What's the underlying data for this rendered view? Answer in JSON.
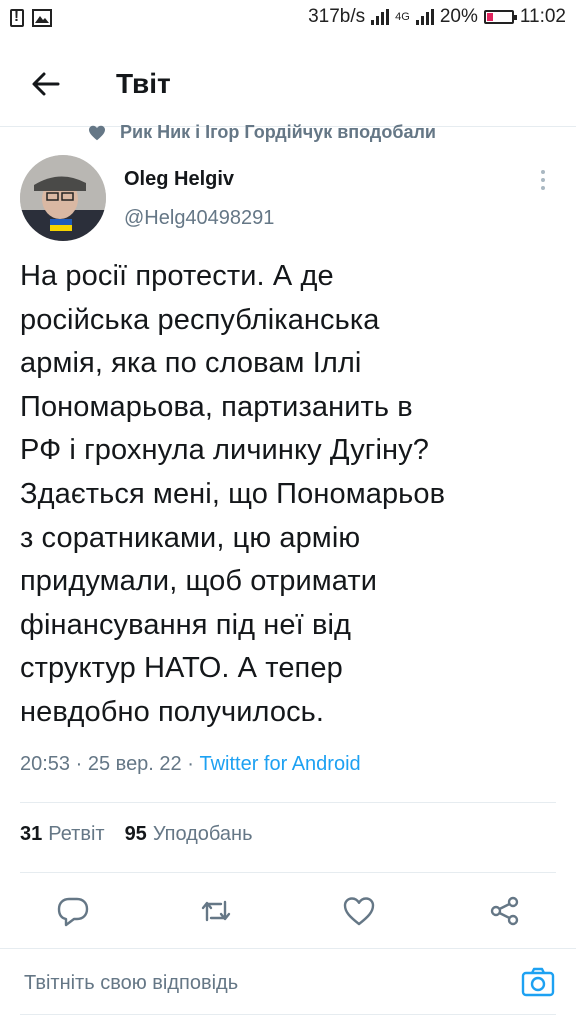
{
  "status_bar": {
    "net_speed": "317b/s",
    "network_type": "4G",
    "battery": "20%",
    "time": "11:02",
    "icons": [
      "alert-icon",
      "image-icon",
      "signal-icon",
      "battery-icon"
    ]
  },
  "header": {
    "title": "Твіт",
    "back_icon": "arrow-left-icon"
  },
  "social_context": {
    "text": "Рик Ник і Ігор Гордійчук вподобали",
    "icon": "heart-icon"
  },
  "author": {
    "name": "Oleg Helgiv",
    "handle": "@Helg40498291",
    "more_icon": "more-vertical-icon"
  },
  "tweet": {
    "text": "На росії протести. А де\nросійська республіканська\nармія, яка по словам Іллі\nПономарьова, партизанить в\nРФ і грохнула личинку Дугіну?\nЗдається мені, що Пономарьов\nз соратниками, цю армію\nпридумали, щоб отримати\nфінансування під неї від\nструктур НАТО. А тепер\nневдобно получилось.",
    "time": "20:53",
    "separator": "·",
    "date": "25 вер. 22",
    "source": "Twitter for Android"
  },
  "stats": {
    "retweets_count": "31",
    "retweets_label": "Ретвіт",
    "likes_count": "95",
    "likes_label": "Уподобань"
  },
  "actions": [
    "reply-icon",
    "retweet-icon",
    "like-icon",
    "share-icon"
  ],
  "reply_bar": {
    "placeholder": "Твітніть свою відповідь",
    "icon": "camera-icon"
  },
  "colors": {
    "accent": "#1da1f2",
    "secondary_text": "#657786",
    "primary_text": "#14171a",
    "divider": "#e6ecf0"
  }
}
